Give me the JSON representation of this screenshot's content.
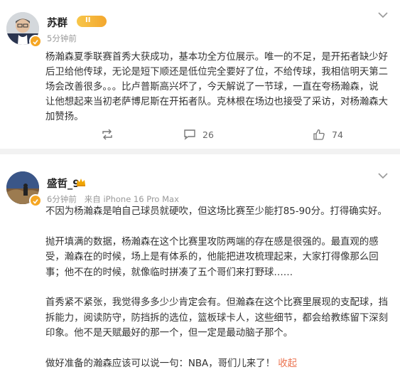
{
  "post1": {
    "author": "苏群",
    "level_badge": "II",
    "time": "5分钟前",
    "lines": [
      "杨瀚森夏季联赛首秀大获成功，基本功全方位展示。唯一的不足，是开拓者缺少好",
      "后卫给他传球，无论是短下顺还是低位完全要好了位，不给传球，我相信明天第二",
      "场会改善很多。。。比卢普斯高兴坏了，今天解说了一节球，一直在夸杨瀚森，说",
      "让他想起来当初老萨博尼斯在开拓者队。克林根在场边也接受了采访，对杨瀚森大",
      "加赞扬。"
    ],
    "actions": {
      "repost": "",
      "comments": "26",
      "likes": "74"
    }
  },
  "post2": {
    "author": "盛哲_9",
    "time": "6分钟前",
    "source": "来自 iPhone 16 Pro Max",
    "paragraphs": [
      [
        "不因为杨瀚森是咱自己球员就硬吹，但这场比赛至少能打85-90分。打得确实好。"
      ],
      [
        "抛开填满的数据，杨瀚森在这个比赛里攻防两端的存在感是很强的。最直观的感",
        "受，瀚森在的时候，场上是有体系的，他能把进攻梳理起来，大家打得像那么回",
        "事；他不在的时候，就像临时拼凑了五个哥们来打野球……"
      ],
      [
        "首秀紧不紧张，我觉得多多少少肯定会有。但瀚森在这个比赛里展现的支配球，挡",
        "拆能力，阅读防守，防挡拆的选位，篮板球卡人，这些细节，都会给教练留下深刻",
        "印象。他不是天赋最好的那一个，但一定是最动脑子那个。"
      ],
      [
        "做好准备的瀚森应该可以说一句：NBA，哥们儿来了！"
      ]
    ],
    "expand_label": "收起"
  },
  "colors": {
    "accent": "#eb7350",
    "verified": "#f5a623",
    "muted": "#999999"
  }
}
